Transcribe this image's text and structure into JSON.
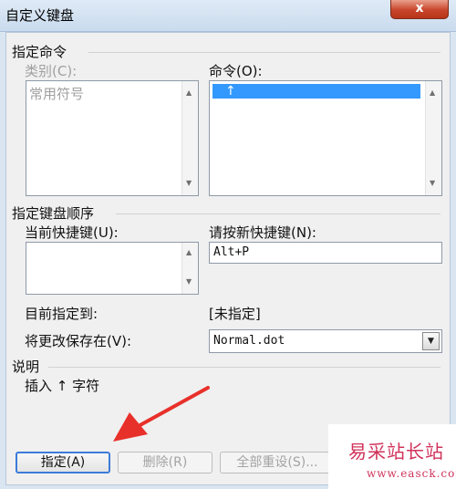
{
  "window": {
    "title": "自定义键盘",
    "close_label": "x"
  },
  "specify_command": {
    "group_label": "指定命令",
    "category_label": "类别(C):",
    "category_items": [
      "常用符号"
    ],
    "commands_label": "命令(O):",
    "command_items": [
      "↑"
    ]
  },
  "keyboard_sequence": {
    "group_label": "指定键盘顺序",
    "current_keys_label": "当前快捷键(U):",
    "new_key_label": "请按新快捷键(N):",
    "new_key_value": "Alt+P"
  },
  "assignment": {
    "currently_assigned_label": "目前指定到:",
    "currently_assigned_value": "[未指定]",
    "save_in_label": "将更改保存在(V):",
    "save_in_value": "Normal.dot"
  },
  "description": {
    "group_label": "说明",
    "text": "插入 ↑ 字符"
  },
  "buttons": {
    "assign": "指定(A)",
    "remove": "删除(R)",
    "reset_all": "全部重设(S)..."
  },
  "watermark": {
    "line1": "易采站长站",
    "line2": "www.easck.com"
  },
  "colors": {
    "annotation_arrow": "#e8302a",
    "selection": "#3399ff",
    "watermark": "#d0325a"
  }
}
